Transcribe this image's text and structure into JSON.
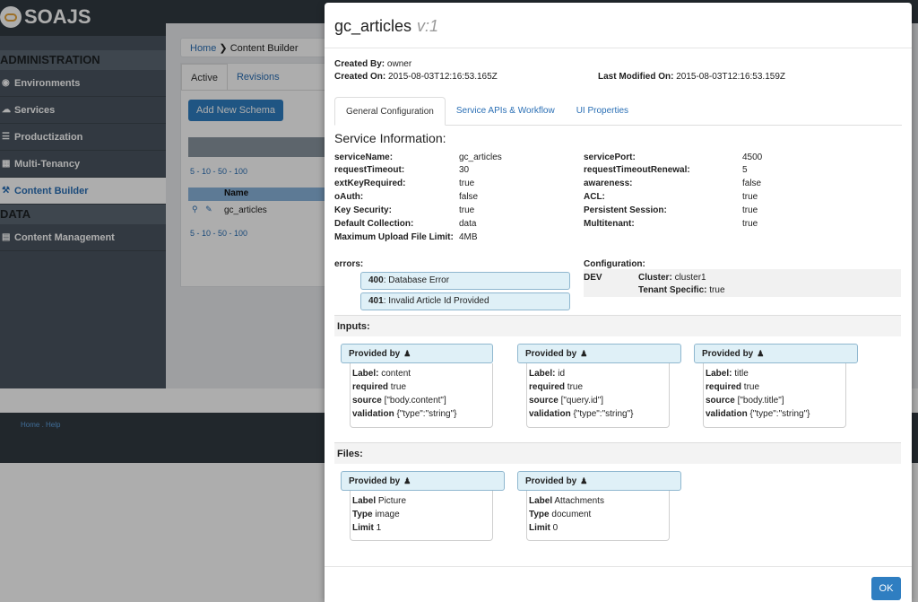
{
  "app": {
    "logo_text": "SOAJS"
  },
  "sidebar": {
    "sections": [
      {
        "title": "ADMINISTRATION"
      },
      {
        "title": "DATA"
      }
    ],
    "items": [
      {
        "label": "Environments",
        "icon": "globe-icon"
      },
      {
        "label": "Services",
        "icon": "cloud-icon"
      },
      {
        "label": "Productization",
        "icon": "list-icon"
      },
      {
        "label": "Multi-Tenancy",
        "icon": "sitemap-icon"
      },
      {
        "label": "Content Builder",
        "icon": "wrench-icon",
        "active": true
      },
      {
        "label": "Content Management",
        "icon": "card-icon"
      }
    ]
  },
  "breadcrumb": {
    "home": "Home",
    "current": "Content Builder"
  },
  "tabs": {
    "active": "Active",
    "revisions": "Revisions"
  },
  "buttons": {
    "add_schema": "Add New Schema",
    "ok": "OK"
  },
  "grid": {
    "pager": "5 - 10 - 50 - 100",
    "name_header": "Name",
    "row_name": "gc_articles"
  },
  "footer": {
    "links": "Home . Help"
  },
  "modal": {
    "title": "gc_articles",
    "version": "v:1",
    "created_by_label": "Created By:",
    "created_by": "owner",
    "created_on_label": "Created On:",
    "created_on": "2015-08-03T12:16:53.165Z",
    "last_modified_label": "Last Modified On:",
    "last_modified": "2015-08-03T12:16:53.159Z",
    "tabs": [
      "General Configuration",
      "Service APIs & Workflow",
      "UI Properties"
    ],
    "service_info_title": "Service Information:",
    "left_fields": [
      {
        "label": "serviceName:",
        "value": "gc_articles"
      },
      {
        "label": "requestTimeout:",
        "value": "30"
      },
      {
        "label": "extKeyRequired:",
        "value": "true"
      },
      {
        "label": "oAuth:",
        "value": "false"
      },
      {
        "label": "Key Security:",
        "value": "true"
      },
      {
        "label": "Default Collection:",
        "value": "data"
      },
      {
        "label": "Maximum Upload File Limit:",
        "value": "4MB"
      }
    ],
    "right_fields": [
      {
        "label": "servicePort:",
        "value": "4500"
      },
      {
        "label": "requestTimeoutRenewal:",
        "value": "5"
      },
      {
        "label": "awareness:",
        "value": "false"
      },
      {
        "label": "ACL:",
        "value": "true"
      },
      {
        "label": "Persistent Session:",
        "value": "true"
      },
      {
        "label": "Multitenant:",
        "value": "true"
      }
    ],
    "errors_label": "errors:",
    "errors": [
      {
        "code": "400",
        "message": ": Database Error"
      },
      {
        "code": "401",
        "message": ": Invalid Article Id Provided"
      }
    ],
    "configuration_label": "Configuration:",
    "config": {
      "env": "DEV",
      "cluster_label": "Cluster:",
      "cluster": "cluster1",
      "tenant_label": "Tenant Specific:",
      "tenant": "true"
    },
    "inputs_title": "Inputs:",
    "inputs": [
      {
        "header": "Provided by",
        "label": "content",
        "required": "true",
        "source": "[\"body.content\"]",
        "validation": "{\"type\":\"string\"}"
      },
      {
        "header": "Provided by",
        "label": "id",
        "required": "true",
        "source": "[\"query.id\"]",
        "validation": "{\"type\":\"string\"}"
      },
      {
        "header": "Provided by",
        "label": "title",
        "required": "true",
        "source": "[\"body.title\"]",
        "validation": "{\"type\":\"string\"}"
      }
    ],
    "input_keys": {
      "label": "Label:",
      "required": "required",
      "source": "source",
      "validation": "validation"
    },
    "files_title": "Files:",
    "files": [
      {
        "header": "Provided by",
        "label": "Picture",
        "type": "image",
        "limit": "1"
      },
      {
        "header": "Provided by",
        "label": "Attachments",
        "type": "document",
        "limit": "0"
      }
    ],
    "file_keys": {
      "label": "Label",
      "type": "Type",
      "limit": "Limit"
    }
  }
}
